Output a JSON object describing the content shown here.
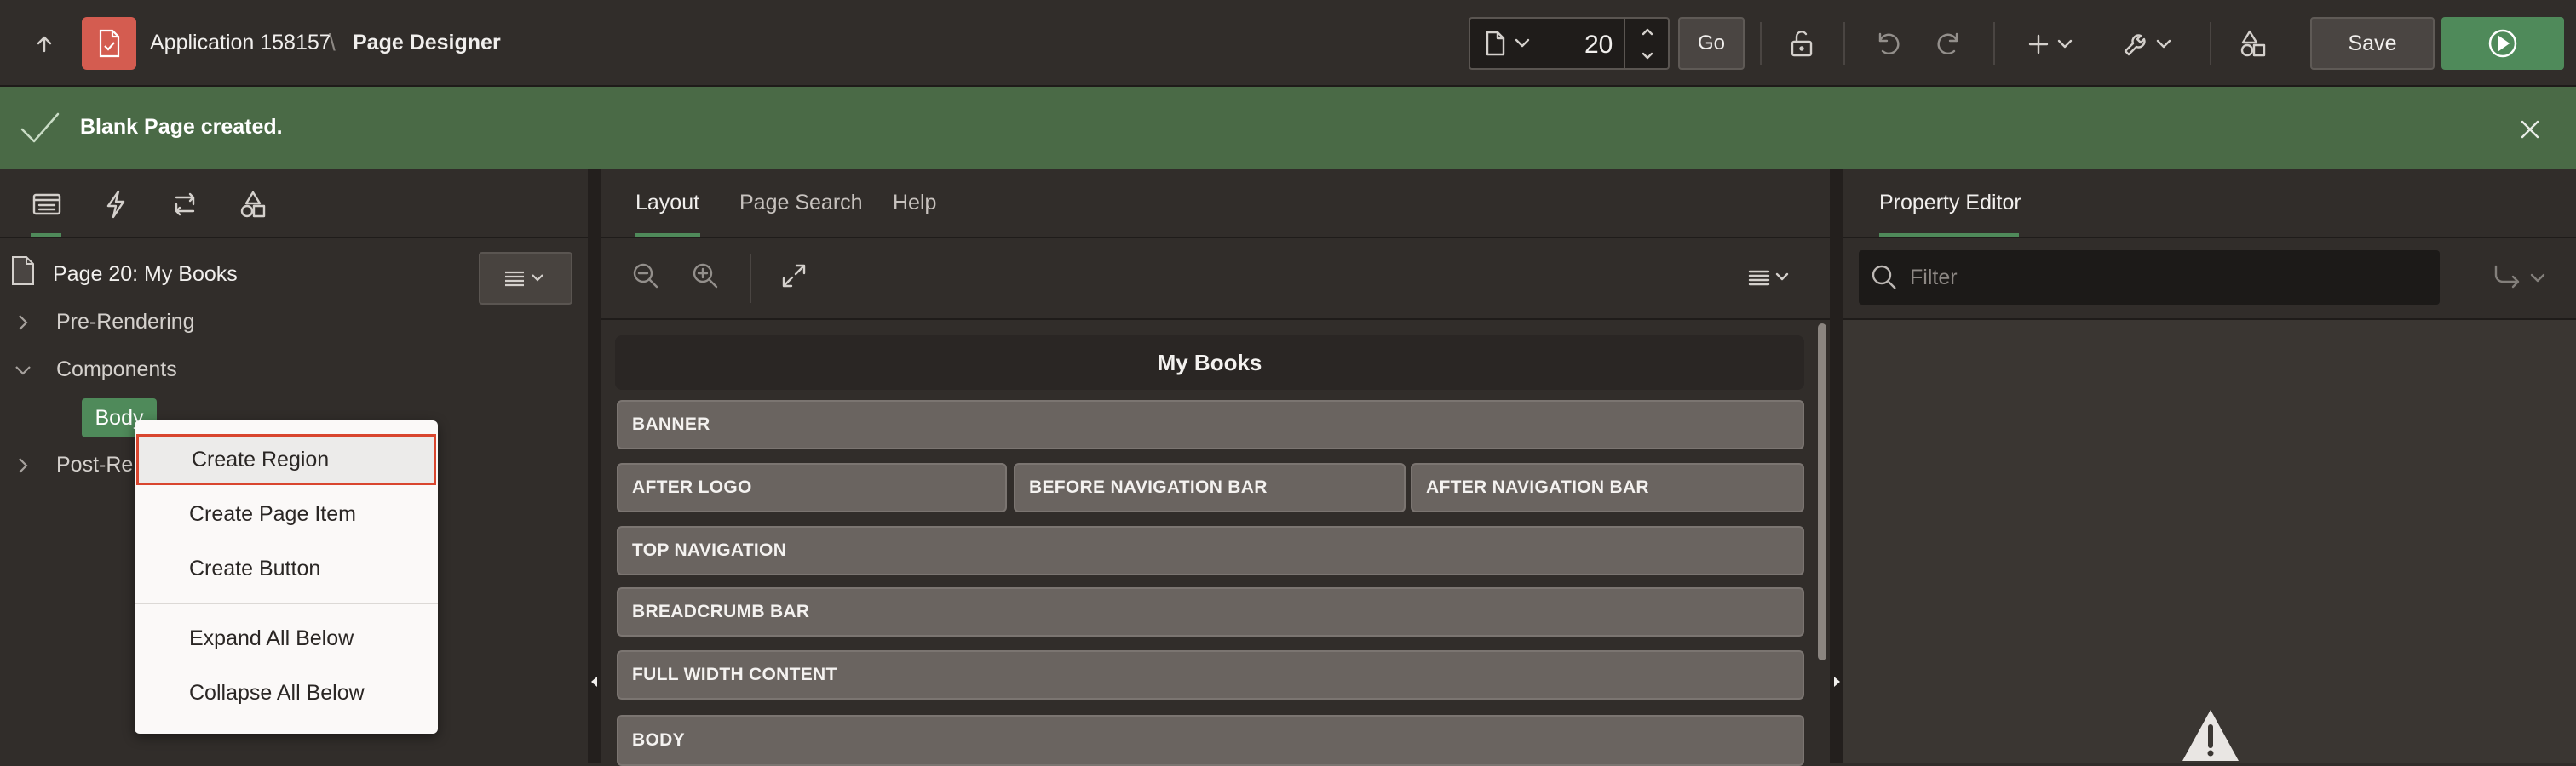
{
  "header": {
    "breadcrumb_app": "Application 158157",
    "breadcrumb_sep": "\\",
    "breadcrumb_page": "Page Designer",
    "page_number": "20",
    "go_label": "Go",
    "save_label": "Save",
    "accent_color": "#4f8a5a"
  },
  "notification": {
    "message": "Blank Page created."
  },
  "left_panel": {
    "tabs": [
      "rendering-tab",
      "dynamic-actions-tab",
      "processing-tab",
      "shared-components-tab"
    ],
    "page_title": "Page 20: My Books",
    "tree": {
      "pre_rendering": "Pre-Rendering",
      "components": "Components",
      "body": "Body",
      "post_rendering": "Post-Rendering"
    }
  },
  "context_menu": {
    "items": [
      "Create Region",
      "Create Page Item",
      "Create Button",
      "Expand All Below",
      "Collapse All Below"
    ]
  },
  "center_panel": {
    "tabs": [
      "Layout",
      "Page Search",
      "Help"
    ],
    "page_header": "My Books",
    "slots": {
      "banner": "BANNER",
      "after_logo": "AFTER LOGO",
      "before_nav": "BEFORE NAVIGATION BAR",
      "after_nav": "AFTER NAVIGATION BAR",
      "top_nav": "TOP NAVIGATION",
      "breadcrumb": "BREADCRUMB BAR",
      "full_width": "FULL WIDTH CONTENT",
      "body": "BODY"
    }
  },
  "right_panel": {
    "tab": "Property Editor",
    "filter_placeholder": "Filter"
  }
}
